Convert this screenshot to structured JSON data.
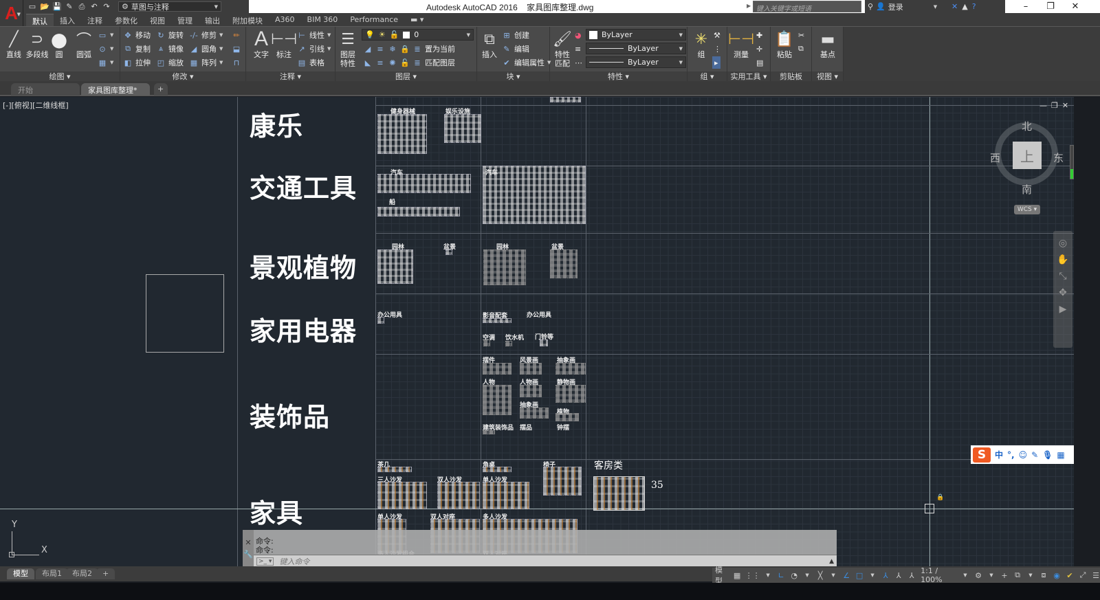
{
  "window": {
    "title": "Autodesk AutoCAD 2016    家具图库整理.dwg",
    "minimize": "–",
    "restore": "❐",
    "close": "✕"
  },
  "qat": {
    "workspace": "草图与注释",
    "icons": [
      "new-icon",
      "open-icon",
      "save-icon",
      "saveas-icon",
      "print-icon",
      "undo-icon",
      "redo-icon"
    ]
  },
  "search": {
    "placeholder": "键入关键字或短语"
  },
  "signin": {
    "label": "登录"
  },
  "ribbon_tabs": [
    "默认",
    "插入",
    "注释",
    "参数化",
    "视图",
    "管理",
    "输出",
    "附加模块",
    "A360",
    "BIM 360",
    "Performance"
  ],
  "panels": {
    "draw": {
      "title": "绘图",
      "line": "直线",
      "polyline": "多段线",
      "circle": "圆",
      "arc": "圆弧"
    },
    "modify": {
      "title": "修改",
      "move": "移动",
      "rotate": "旋转",
      "trim": "修剪",
      "copy": "复制",
      "mirror": "镜像",
      "fillet": "圆角",
      "stretch": "拉伸",
      "scale": "缩放",
      "array": "阵列"
    },
    "annotation": {
      "title": "注释",
      "text": "文字",
      "dimension": "标注",
      "linear": "线性",
      "leader": "引线",
      "table": "表格"
    },
    "layers": {
      "title": "图层",
      "properties": "图层\n特性",
      "current_layer": "0",
      "set_current": "置为当前",
      "match_layer": "匹配图层"
    },
    "block": {
      "title": "块",
      "insert": "插入",
      "create": "创建",
      "edit": "编辑",
      "edit_attr": "编辑属性"
    },
    "properties": {
      "title": "特性",
      "match": "特性\n匹配",
      "color": "ByLayer",
      "linetype": "ByLayer",
      "lineweight": "ByLayer"
    },
    "groups": {
      "title": "组",
      "group": "组"
    },
    "utilities": {
      "title": "实用工具",
      "measure": "测量"
    },
    "clipboard": {
      "title": "剪贴板",
      "paste": "粘贴"
    },
    "view": {
      "title": "视图",
      "base": "基点"
    }
  },
  "file_tabs": [
    {
      "label": "开始"
    },
    {
      "label": "家具图库整理*",
      "close": "×"
    }
  ],
  "viewport": {
    "controls": "[-][俯视][二维线框]"
  },
  "drawing": {
    "categories": [
      "康乐",
      "交通工具",
      "景观植物",
      "家用电器",
      "装饰品",
      "家具"
    ],
    "labels": {
      "fitness": "健身器械",
      "entertainment": "娱乐设施",
      "car1": "汽车",
      "car2": "汽车",
      "boat": "船",
      "garden1": "园林",
      "bonsai1": "盆景",
      "garden2": "园林",
      "bonsai2": "盆景",
      "office1": "办公用具",
      "av": "影音配套",
      "office2": "办公用具",
      "ac": "空调",
      "water": "饮水机",
      "doorbell": "门铃等",
      "decor": "摆件",
      "landscape_painting": "风景画",
      "abstract_painting": "抽象画",
      "people": "人物",
      "people_painting": "人物画",
      "still_life": "静物画",
      "abstract2": "抽象画",
      "plant": "植物",
      "partition": "建筑装饰品",
      "gift": "摆品",
      "clock": "钟摆",
      "coffee": "茶几",
      "sofa3": "三人沙发",
      "sofa2": "双人沙发",
      "corner": "角桌",
      "sofa1": "单人沙发",
      "chair": "椅子",
      "guestroom": "客房类",
      "single_sofa": "单人沙发",
      "double_seat": "双人对座",
      "multi_sofa": "多人沙发",
      "multi_combo": "多人沙发组合",
      "double_pair": "双人对座"
    },
    "number_label": "35"
  },
  "viewcube": {
    "north": "北",
    "south": "南",
    "east": "东",
    "west": "西",
    "face": "上",
    "wcs": "WCS"
  },
  "command": {
    "history": [
      "命令:",
      "命令:"
    ],
    "placeholder": "键入命令"
  },
  "ucs": {
    "x": "X",
    "y": "Y"
  },
  "layout_tabs": [
    "模型",
    "布局1",
    "布局2"
  ],
  "statusbar": {
    "model": "模型",
    "scale": "1:1 / 100%"
  },
  "ime": {
    "lang": "中",
    "punct": "°,"
  }
}
